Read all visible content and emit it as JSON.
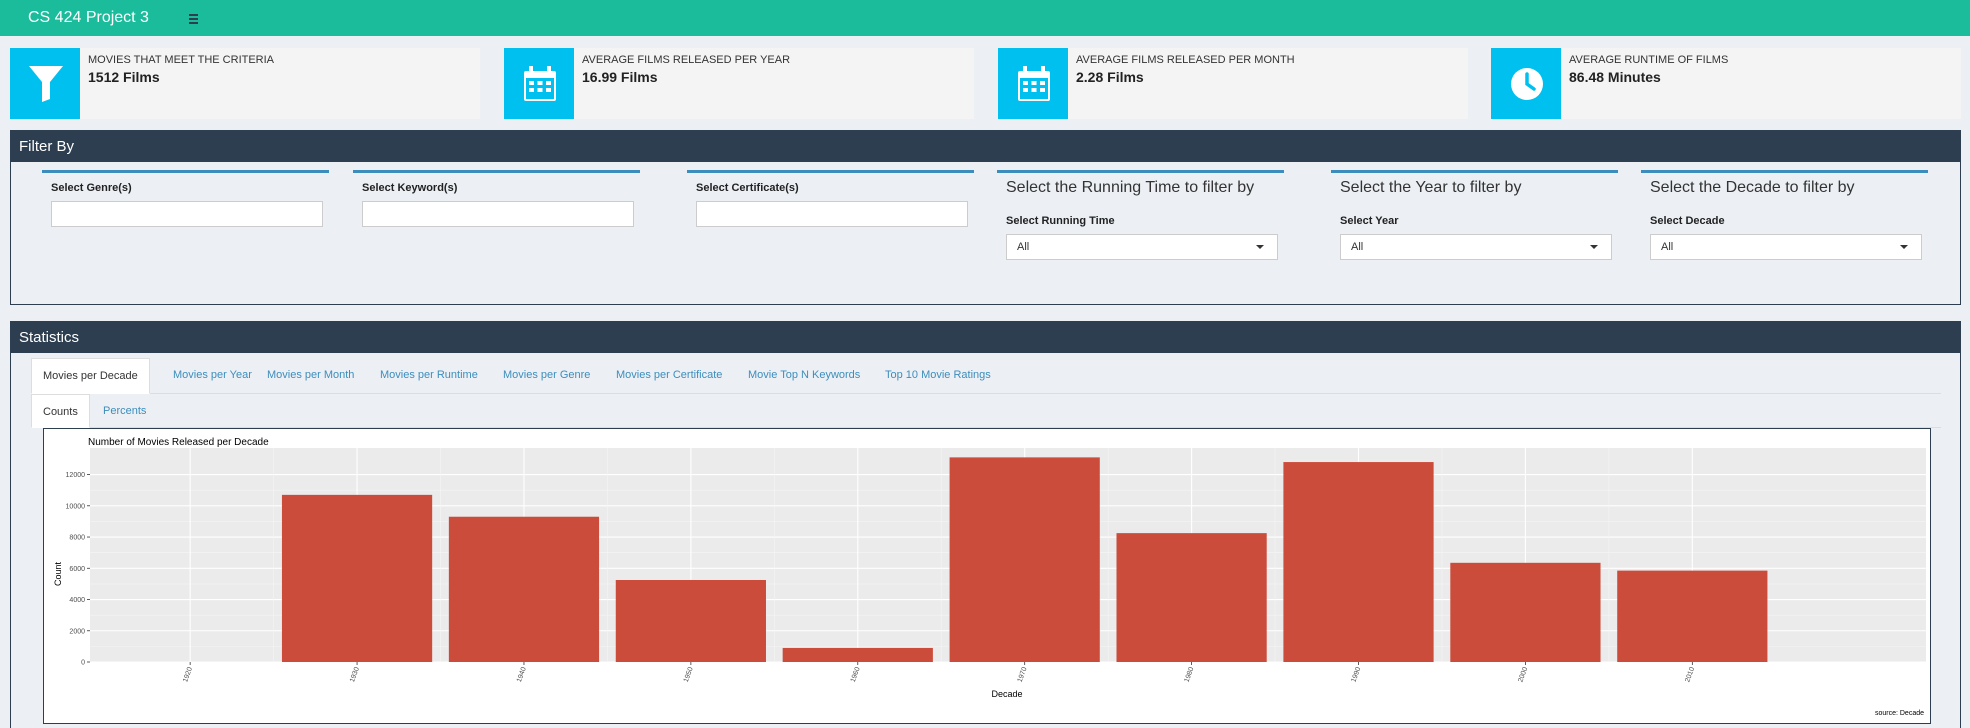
{
  "header": {
    "title": "CS 424 Project 3",
    "menu_icon": "hamburger-icon"
  },
  "info_boxes": [
    {
      "label": "MOVIES THAT MEET THE CRITERIA",
      "value": "1512 Films",
      "icon": "filter-icon",
      "color": "#00c0ef"
    },
    {
      "label": "AVERAGE FILMS RELEASED PER YEAR",
      "value": "16.99 Films",
      "icon": "calendar-icon",
      "color": "#00c0ef"
    },
    {
      "label": "AVERAGE FILMS RELEASED PER MONTH",
      "value": "2.28 Films",
      "icon": "calendar-icon",
      "color": "#00c0ef"
    },
    {
      "label": "AVERAGE RUNTIME OF FILMS",
      "value": "86.48 Minutes",
      "icon": "clock-icon",
      "color": "#00c0ef"
    }
  ],
  "filter": {
    "title": "Filter By",
    "genre_label": "Select Genre(s)",
    "keyword_label": "Select Keyword(s)",
    "certificate_label": "Select Certificate(s)",
    "runtime_heading": "Select the Running Time to filter by",
    "runtime_label": "Select Running Time",
    "runtime_value": "All",
    "year_heading": "Select the Year to filter by",
    "year_label": "Select Year",
    "year_value": "All",
    "decade_heading": "Select the Decade to filter by",
    "decade_label": "Select Decade",
    "decade_value": "All"
  },
  "statistics": {
    "title": "Statistics",
    "tabs": [
      "Movies per Decade",
      "Movies per Year",
      "Movies per Month",
      "Movies per Runtime",
      "Movies per Genre",
      "Movies per Certificate",
      "Movie Top N Keywords",
      "Top 10 Movie Ratings"
    ],
    "active_tab": 0,
    "subtabs": [
      "Counts",
      "Percents"
    ],
    "active_subtab": 0
  },
  "chart_data": {
    "type": "bar",
    "title": "Number of Movies Released per Decade",
    "xlabel": "Decade",
    "ylabel": "Count",
    "caption": "source: Decade",
    "categories": [
      "1920",
      "1930",
      "1940",
      "1950",
      "1960",
      "1970",
      "1980",
      "1990",
      "2000",
      "2010"
    ],
    "values": [
      0,
      10700,
      9300,
      5250,
      900,
      13100,
      8250,
      12800,
      6350,
      5850
    ],
    "ylim": [
      0,
      13700
    ],
    "yticks": [
      0,
      2000,
      4000,
      6000,
      8000,
      10000,
      12000
    ],
    "bar_color": "#cc4c3b",
    "grid": true
  }
}
